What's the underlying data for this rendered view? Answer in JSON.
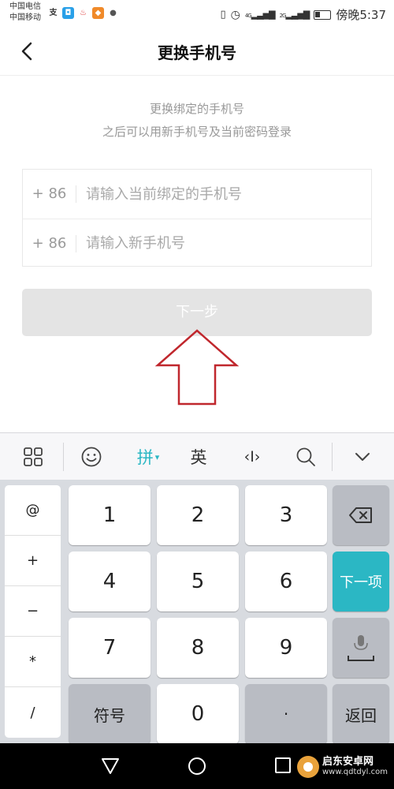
{
  "status_bar": {
    "carrier1": "中国电信",
    "carrier2": "中国移动",
    "net_4g": "4G",
    "net_2g": "2G",
    "time": "傍晚5:37"
  },
  "header": {
    "title": "更换手机号"
  },
  "description": {
    "line1": "更换绑定的手机号",
    "line2": "之后可以用新手机号及当前密码登录"
  },
  "form": {
    "rows": [
      {
        "prefix": "+ 86",
        "placeholder": "请输入当前绑定的手机号",
        "value": ""
      },
      {
        "prefix": "+ 86",
        "placeholder": "请输入新手机号",
        "value": ""
      }
    ]
  },
  "next_button": {
    "label": "下一步",
    "color": "#e4e4e4"
  },
  "annotation": {
    "arrow_color": "#c0272d"
  },
  "keyboard": {
    "toolbar": {
      "pinyin": "拼",
      "english": "英",
      "cursor": "‹I›",
      "accent": "#2bb7c4"
    },
    "side_keys": [
      "@",
      "+",
      "−",
      "*",
      "/"
    ],
    "keys": {
      "k1": "1",
      "k2": "2",
      "k3": "3",
      "k4": "4",
      "k5": "5",
      "k6": "6",
      "k7": "7",
      "k8": "8",
      "k9": "9",
      "symbol": "符号",
      "zero": "0",
      "dot": "·",
      "next_item": "下一项",
      "return": "返回"
    }
  },
  "watermark": {
    "title": "启东安卓网",
    "url": "www.qdtdyl.com"
  }
}
